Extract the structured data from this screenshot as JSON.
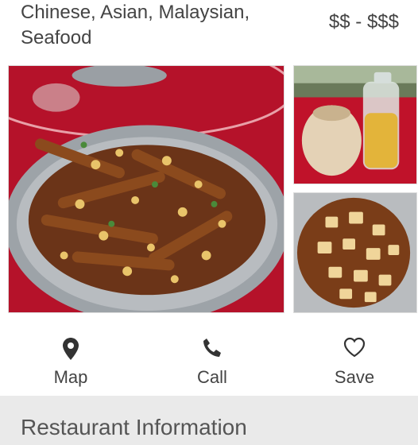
{
  "header": {
    "cuisine": "Chinese, Asian, Malaysian, Seafood",
    "price": "$$ - $$$"
  },
  "photos": [
    {
      "name": "razor-clam-dish-photo"
    },
    {
      "name": "coconut-drink-photo"
    },
    {
      "name": "tofu-dish-photo"
    }
  ],
  "actions": {
    "map": {
      "label": "Map",
      "icon": "map-pin-icon"
    },
    "call": {
      "label": "Call",
      "icon": "phone-icon"
    },
    "save": {
      "label": "Save",
      "icon": "heart-icon"
    }
  },
  "section": {
    "title": "Restaurant Information"
  },
  "colors": {
    "text": "#444444",
    "section_bg": "#eaeaea",
    "tablecloth": "#c8102e"
  }
}
